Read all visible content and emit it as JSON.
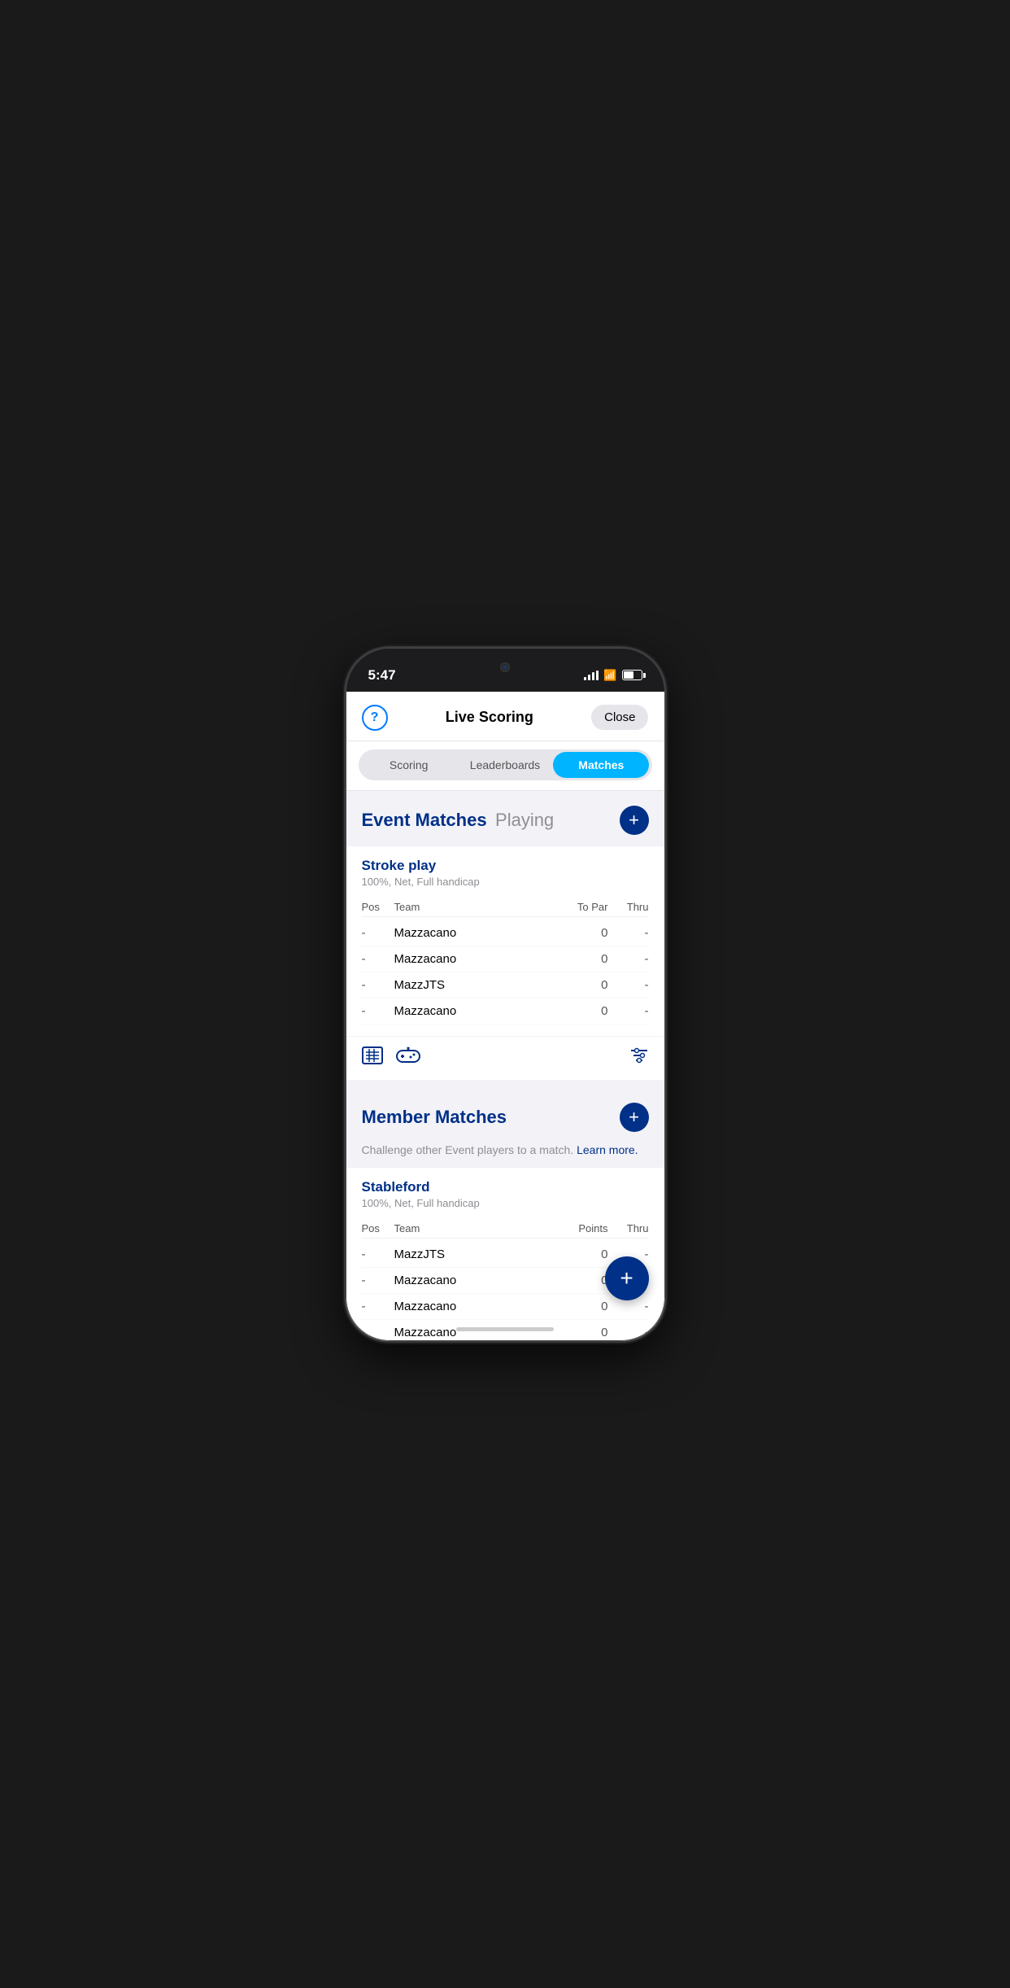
{
  "statusBar": {
    "time": "5:47"
  },
  "header": {
    "title": "Live Scoring",
    "closeLabel": "Close",
    "helpIcon": "?"
  },
  "tabs": [
    {
      "id": "scoring",
      "label": "Scoring",
      "active": false
    },
    {
      "id": "leaderboards",
      "label": "Leaderboards",
      "active": false
    },
    {
      "id": "matches",
      "label": "Matches",
      "active": true
    }
  ],
  "eventMatches": {
    "title": "Event Matches",
    "subtitle": "Playing",
    "addIcon": "+",
    "strokePlay": {
      "title": "Stroke play",
      "subtitle": "100%, Net, Full handicap",
      "columns": [
        "Pos",
        "Team",
        "To Par",
        "Thru"
      ],
      "rows": [
        {
          "pos": "-",
          "team": "Mazzacano",
          "score": "0",
          "thru": "-"
        },
        {
          "pos": "-",
          "team": "Mazzacano",
          "score": "0",
          "thru": "-"
        },
        {
          "pos": "-",
          "team": "MazzJTS",
          "score": "0",
          "thru": "-"
        },
        {
          "pos": "-",
          "team": "Mazzacano",
          "score": "0",
          "thru": "-"
        }
      ]
    }
  },
  "memberMatches": {
    "title": "Member Matches",
    "addIcon": "+",
    "challengeText": "Challenge other Event players to a match.",
    "learnMoreLabel": "Learn more.",
    "stableford": {
      "title": "Stableford",
      "subtitle": "100%, Net, Full handicap",
      "columns": [
        "Pos",
        "Team",
        "Points",
        "Thru"
      ],
      "rows": [
        {
          "pos": "-",
          "team": "MazzJTS",
          "score": "0",
          "thru": "-"
        },
        {
          "pos": "-",
          "team": "Mazzacano",
          "score": "0",
          "thru": "-"
        },
        {
          "pos": "-",
          "team": "Mazzacano",
          "score": "0",
          "thru": "-"
        },
        {
          "pos": "-",
          "team": "Mazzacano",
          "score": "0",
          "thru": "-"
        }
      ]
    }
  },
  "fab": {
    "label": "+"
  }
}
